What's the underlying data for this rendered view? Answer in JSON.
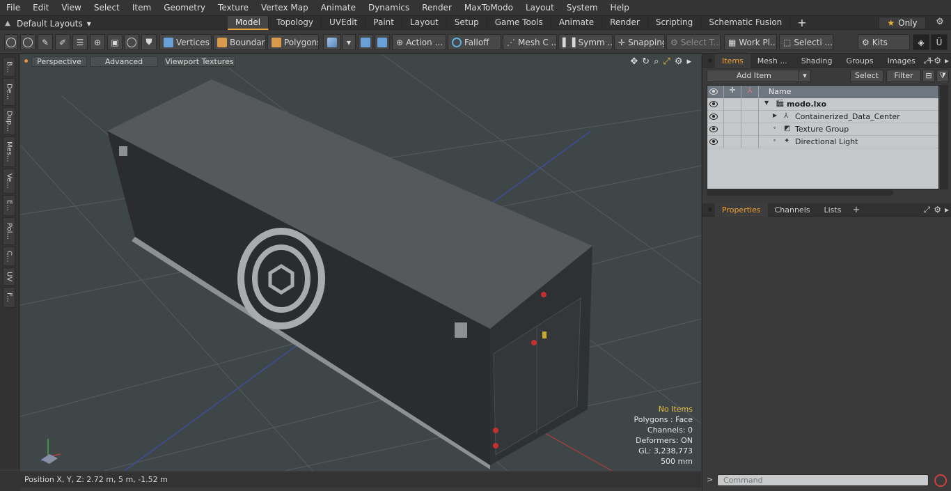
{
  "menu": [
    "File",
    "Edit",
    "View",
    "Select",
    "Item",
    "Geometry",
    "Texture",
    "Vertex Map",
    "Animate",
    "Dynamics",
    "Render",
    "MaxToModo",
    "Layout",
    "System",
    "Help"
  ],
  "layout_selector": "Default Layouts",
  "tabs": [
    "Model",
    "Topology",
    "UVEdit",
    "Paint",
    "Layout",
    "Setup",
    "Game Tools",
    "Animate",
    "Render",
    "Scripting",
    "Schematic Fusion"
  ],
  "tabs_plus": "+",
  "only_label": "Only",
  "toolbar": {
    "vertices": "Vertices",
    "boundary": "Boundary",
    "polygons": "Polygons",
    "action": "Action",
    "action_more": "...",
    "falloff": "Falloff",
    "mesh_c": "Mesh C ...",
    "symm": "Symm ...",
    "snapping": "Snapping",
    "select_t": "Select T...",
    "work_pl": "Work Pl...",
    "selecti": "Selecti ...",
    "kits": "Kits"
  },
  "left_tabs": [
    "B...",
    "De...",
    "Dup...",
    "Mes...",
    "Ve...",
    "E...",
    "Pol...",
    "C...",
    "UV",
    "F..."
  ],
  "viewport": {
    "perspective": "Perspective",
    "advanced": "Advanced",
    "viewport_textures": "Viewport Textures",
    "stats": {
      "no_items": "No Items",
      "polygons": "Polygons : Face",
      "channels": "Channels: 0",
      "deformers": "Deformers: ON",
      "gl": "GL: 3,238,773",
      "scale": "500 mm"
    }
  },
  "status": "Position X, Y, Z:   2.72 m, 5 m, -1.52 m",
  "items_panel": {
    "tabs": [
      "Items",
      "Mesh ...",
      "Shading",
      "Groups",
      "Images"
    ],
    "add_item": "Add Item",
    "select": "Select",
    "filter": "Filter",
    "column_name": "Name",
    "rows": [
      {
        "name": "modo.lxo",
        "indent": 0
      },
      {
        "name": "Containerized_Data_Center",
        "indent": 1
      },
      {
        "name": "Texture Group",
        "indent": 1
      },
      {
        "name": "Directional Light",
        "indent": 1
      }
    ]
  },
  "props_panel": {
    "tabs": [
      "Properties",
      "Channels",
      "Lists"
    ]
  },
  "command": {
    "prompt": ">",
    "placeholder": "Command"
  },
  "colors": {
    "accent": "#e8a03a",
    "viewport_bg": "#3f4647",
    "list_bg": "#c6c9cb"
  }
}
